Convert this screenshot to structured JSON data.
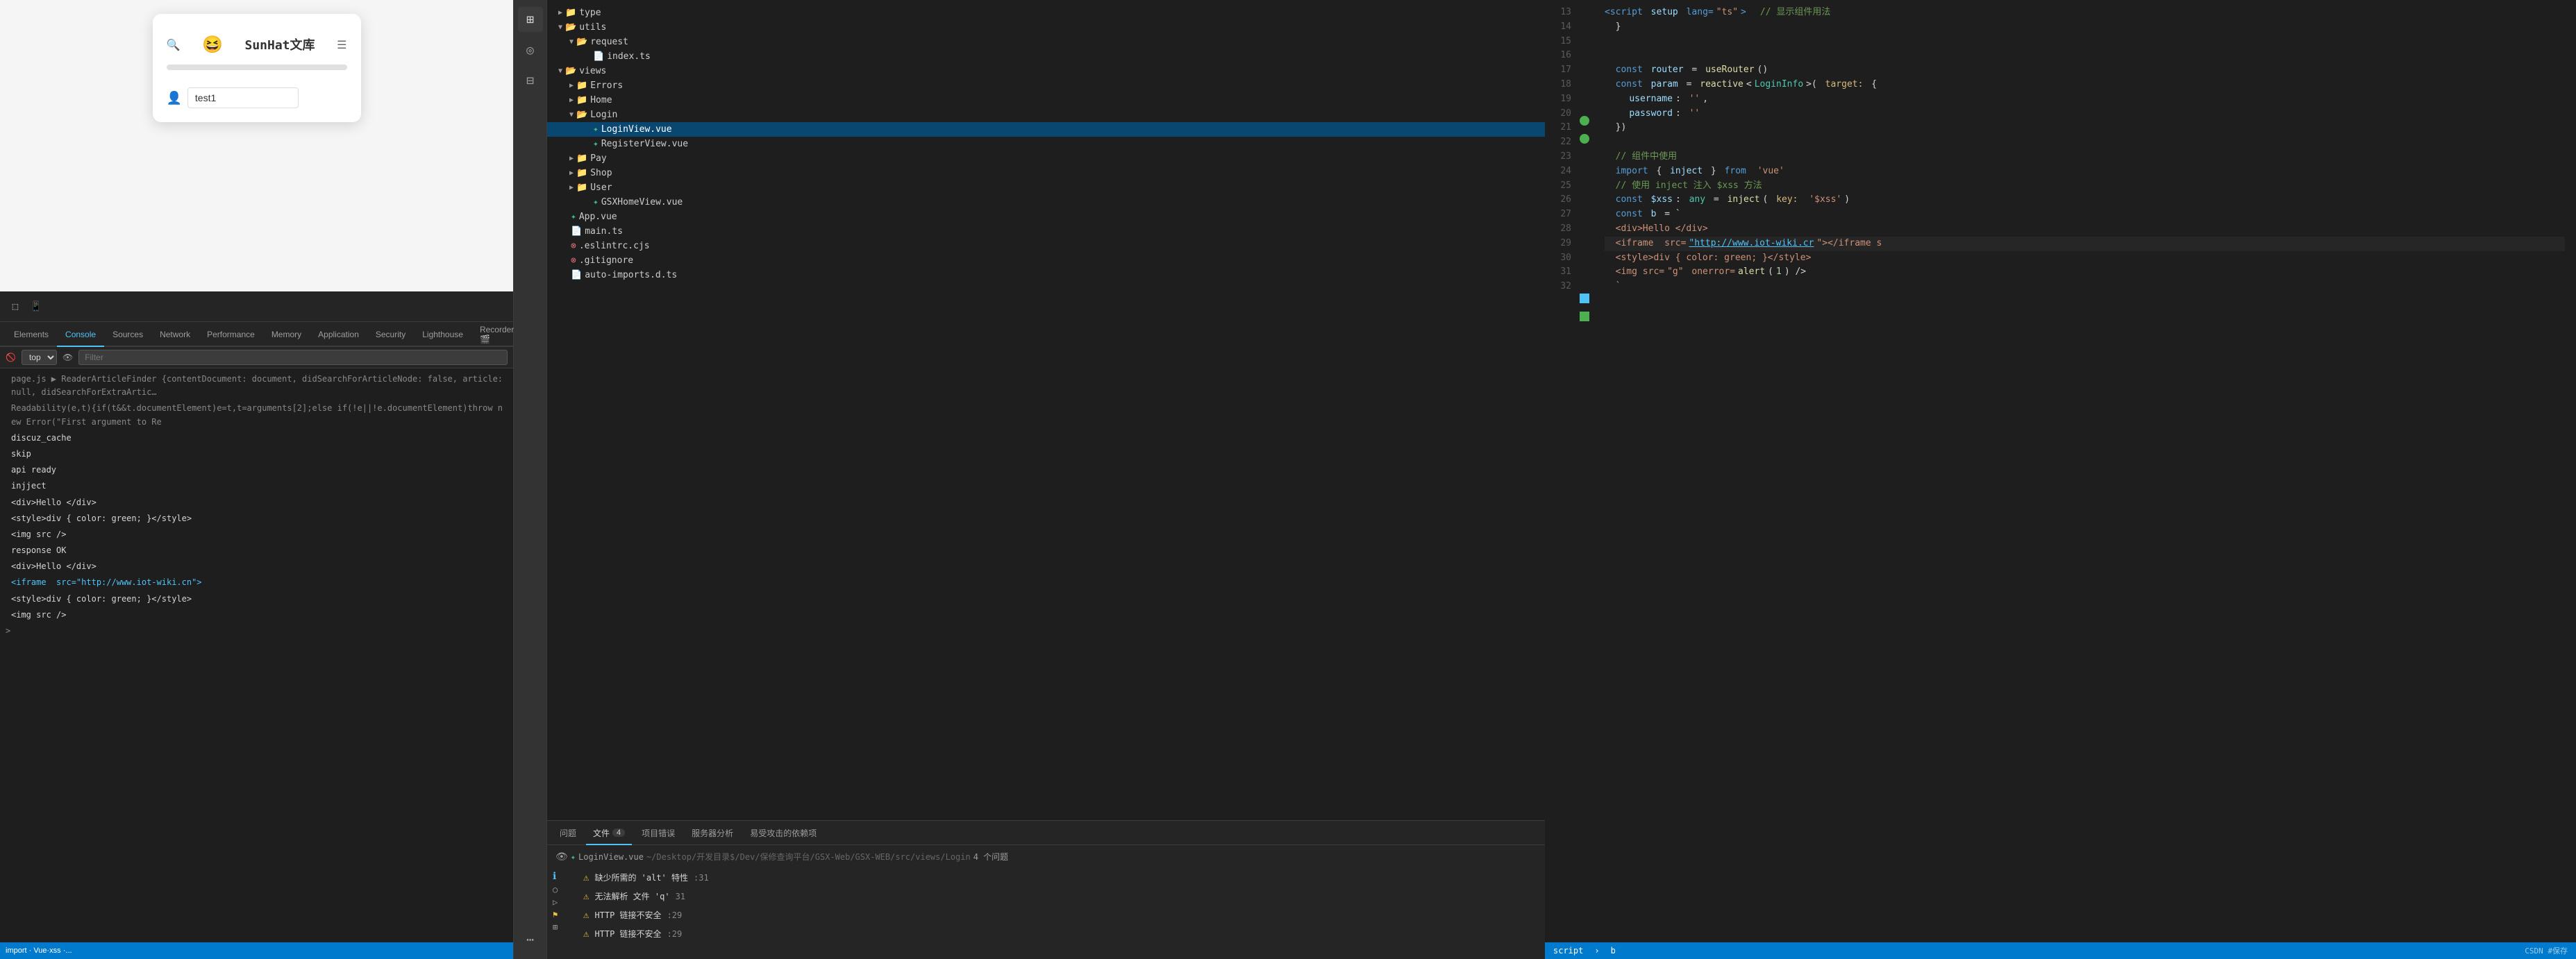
{
  "browser_preview": {
    "site_name": "SunHat文库",
    "user_value": "test1"
  },
  "devtools": {
    "tabs": [
      "Elements",
      "Console",
      "Sources",
      "Network",
      "Performance",
      "Memory",
      "Application",
      "Security",
      "Lighthouse",
      "Recorder 🎬"
    ],
    "active_tab": "Console",
    "filter": {
      "top_label": "top",
      "filter_placeholder": "Filter"
    },
    "console_lines": [
      "page.js ▶ ReaderArticleFinder {contentDocument: document, didSearchForArticleNode: false, article: null, didSearchForExtraArtic…",
      "Readability(e,t){if(t&&t.documentElement)e=t,t=arguments[2];else if(!e||!e.documentElement)throw new Error(\"First argument to Re",
      "discuz_cache",
      "skip",
      "api ready",
      "injject",
      "",
      "<div>Hello </div>",
      "<style>div { color: green; }</style>",
      "<img src />",
      "response OK",
      "",
      "<div>Hello </div>",
      "<iframe  src=\"http://www.iot-wiki.cn\">",
      "<style>div { color: green; }</style>",
      "<img src />",
      ""
    ]
  },
  "file_tree": {
    "items": [
      {
        "label": "type",
        "indent": 1,
        "type": "folder",
        "open": false
      },
      {
        "label": "utils",
        "indent": 1,
        "type": "folder",
        "open": true
      },
      {
        "label": "request",
        "indent": 2,
        "type": "folder",
        "open": true
      },
      {
        "label": "index.ts",
        "indent": 3,
        "type": "ts"
      },
      {
        "label": "views",
        "indent": 1,
        "type": "folder",
        "open": true
      },
      {
        "label": "Errors",
        "indent": 2,
        "type": "folder",
        "open": false
      },
      {
        "label": "Home",
        "indent": 2,
        "type": "folder",
        "open": false
      },
      {
        "label": "Login",
        "indent": 2,
        "type": "folder",
        "open": true
      },
      {
        "label": "LoginView.vue",
        "indent": 3,
        "type": "vue",
        "selected": true
      },
      {
        "label": "RegisterView.vue",
        "indent": 3,
        "type": "vue"
      },
      {
        "label": "Pay",
        "indent": 2,
        "type": "folder",
        "open": false
      },
      {
        "label": "Shop",
        "indent": 2,
        "type": "folder",
        "open": false
      },
      {
        "label": "User",
        "indent": 2,
        "type": "folder",
        "open": false
      },
      {
        "label": "GSXHomeView.vue",
        "indent": 3,
        "type": "vue"
      },
      {
        "label": "App.vue",
        "indent": 1,
        "type": "vue"
      },
      {
        "label": "main.ts",
        "indent": 1,
        "type": "ts"
      },
      {
        "label": ".eslintrc.cjs",
        "indent": 1,
        "type": "config"
      },
      {
        "label": ".gitignore",
        "indent": 1,
        "type": "config"
      },
      {
        "label": "auto-imports.d.ts",
        "indent": 1,
        "type": "ts"
      }
    ]
  },
  "issues": {
    "tabs": [
      {
        "label": "问题",
        "badge": null
      },
      {
        "label": "文件",
        "badge": "4"
      },
      {
        "label": "项目错误",
        "badge": null
      },
      {
        "label": "服务器分析",
        "badge": null
      },
      {
        "label": "易受攻击的依赖项",
        "badge": null
      }
    ],
    "active_tab": "文件",
    "file_path": "LoginView.vue ~/Desktop/开发目录$/Dev/保修查询平台/GSX-Web/GSX-WEB/src/views/Login  4 个问题",
    "items": [
      {
        "type": "warning",
        "text": "缺少所需的 'alt' 特性",
        "line": ":31"
      },
      {
        "type": "warning",
        "text": "无法解析 文件 'q'",
        "line": "31"
      },
      {
        "type": "warning",
        "text": "HTTP 链接不安全",
        "line": ":29"
      },
      {
        "type": "warning",
        "text": "HTTP 链接不安全",
        "line": ":29"
      }
    ]
  },
  "code_editor": {
    "lines": [
      {
        "num": 13,
        "code": "  <script setup lang=\"ts\">  显示组件用法",
        "type": "tag"
      },
      {
        "num": 14,
        "code": "  }"
      },
      {
        "num": 15,
        "code": ""
      },
      {
        "num": 16,
        "code": ""
      },
      {
        "num": 17,
        "code": "  const router = useRouter()"
      },
      {
        "num": 18,
        "code": "  const param = reactive<LoginInfo>( target: {"
      },
      {
        "num": 19,
        "code": "    username: '',",
        "gutter": "circle-green"
      },
      {
        "num": 20,
        "code": "    password: ''",
        "gutter": "circle-green"
      },
      {
        "num": 21,
        "code": "  })"
      },
      {
        "num": 22,
        "code": ""
      },
      {
        "num": 23,
        "code": "  // 组件中使用"
      },
      {
        "num": 24,
        "code": "  import { inject } from 'vue'"
      },
      {
        "num": 25,
        "code": "  // 使用 inject 注入 $xss 方法"
      },
      {
        "num": 26,
        "code": "  const $xss: any = inject( key: '$xss')"
      },
      {
        "num": 27,
        "code": "  const b = `"
      },
      {
        "num": 28,
        "code": "  <div>Hello </div>"
      },
      {
        "num": 29,
        "code": "  <iframe  src=\"http://www.iot-wiki.cr\"></iframe s",
        "gutter": "square-blue",
        "highlight": true
      },
      {
        "num": 30,
        "code": "  <style>div { color: green; }</style>",
        "gutter": "square-green"
      },
      {
        "num": 31,
        "code": "  <img src=\"g\" onerror=alert(1) />"
      },
      {
        "num": 32,
        "code": "  `"
      }
    ],
    "breadcrumb": "script > b"
  },
  "status_bar": {
    "left": "script",
    "right": "b"
  }
}
